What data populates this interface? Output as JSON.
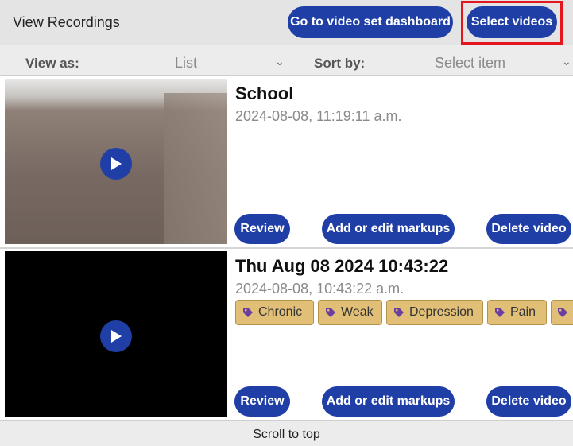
{
  "header": {
    "title": "View Recordings",
    "dashboard_button": "Go to video set dashboard",
    "select_button": "Select videos"
  },
  "controls": {
    "view_as_label": "View as:",
    "view_as_value": "List",
    "sort_by_label": "Sort by:",
    "sort_by_placeholder": "Select item"
  },
  "recordings": [
    {
      "title": "School",
      "date": "2024-08-08, 11:19:11 a.m.",
      "tags": [],
      "review": "Review",
      "markups": "Add or edit markups",
      "delete": "Delete video"
    },
    {
      "title": "Thu Aug 08 2024 10:43:22",
      "date": "2024-08-08, 10:43:22 a.m.",
      "tags": [
        "Chronic",
        "Weak",
        "Depression",
        "Pain"
      ],
      "review": "Review",
      "markups": "Add or edit markups",
      "delete": "Delete video"
    }
  ],
  "footer": {
    "scroll_top": "Scroll to top"
  },
  "colors": {
    "accent": "#1f3fa6",
    "tag": "#e2bf76",
    "tag_icon": "#6b3fa0",
    "highlight": "#e3171d"
  },
  "icons": [
    "play-icon",
    "tag-icon",
    "chevron-down-icon"
  ]
}
